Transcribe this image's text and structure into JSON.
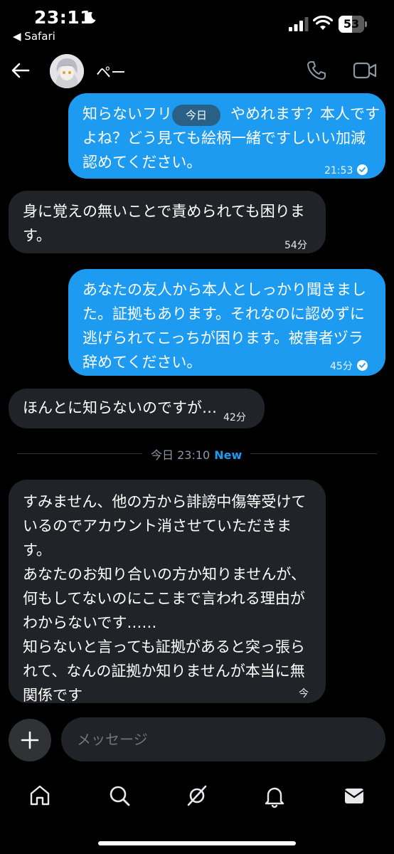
{
  "status_bar": {
    "time": "23:11",
    "back_app": "◀ Safari",
    "battery_percent": "53",
    "battery_level": 0.53
  },
  "header": {
    "contact_name": "ペー"
  },
  "messages": [
    {
      "direction": "outgoing",
      "lines": [
        "知らないフリ",
        "よね？どう見ても絵柄一緒ですしいい加減",
        "認めてください。"
      ],
      "first_line_tail": "やめれます？本人です",
      "time": "21:53",
      "read": true
    },
    {
      "direction": "incoming",
      "lines": [
        "身に覚えの無いことで責められても困りま",
        "す。"
      ],
      "time": "54分"
    },
    {
      "direction": "outgoing",
      "lines": [
        "あなたの友人から本人としっかり聞きまし",
        "た。証拠もあります。それなのに認めずに",
        "逃げられてこっちが困ります。被害者ヅラ",
        "辞めてください。"
      ],
      "time": "45分",
      "read": true
    },
    {
      "direction": "incoming",
      "lines": [
        "ほんとに知らないのですが…"
      ],
      "time": "42分"
    },
    {
      "direction": "incoming",
      "lines": [
        "すみません、他の方から誹謗中傷等受けて",
        "いるのでアカウント消させていただきま",
        "す。",
        "あなたのお知り合いの方か知りませんが、",
        "何もしてないのにここまで言われる理由が",
        "わからないです……",
        "知らないと言っても証拠があると突っ張ら",
        "れて、なんの証拠か知りませんが本当に無",
        "関係です"
      ],
      "time": "今"
    }
  ],
  "today_pill": "今日",
  "divider": {
    "label": "今日 23:10",
    "new_label": "New"
  },
  "composer": {
    "placeholder": "メッセージ"
  },
  "icons": {
    "back": "arrow-left-icon",
    "phone": "phone-icon",
    "video": "video-camera-icon",
    "add": "plus-icon",
    "nav": [
      "home-icon",
      "search-icon",
      "grok-icon",
      "notifications-bell-icon",
      "messages-envelope-icon"
    ]
  },
  "colors": {
    "outgoing_bubble": "#1d9bf0",
    "incoming_bubble": "#202327",
    "accent": "#1d9bf0",
    "background": "#000000"
  }
}
